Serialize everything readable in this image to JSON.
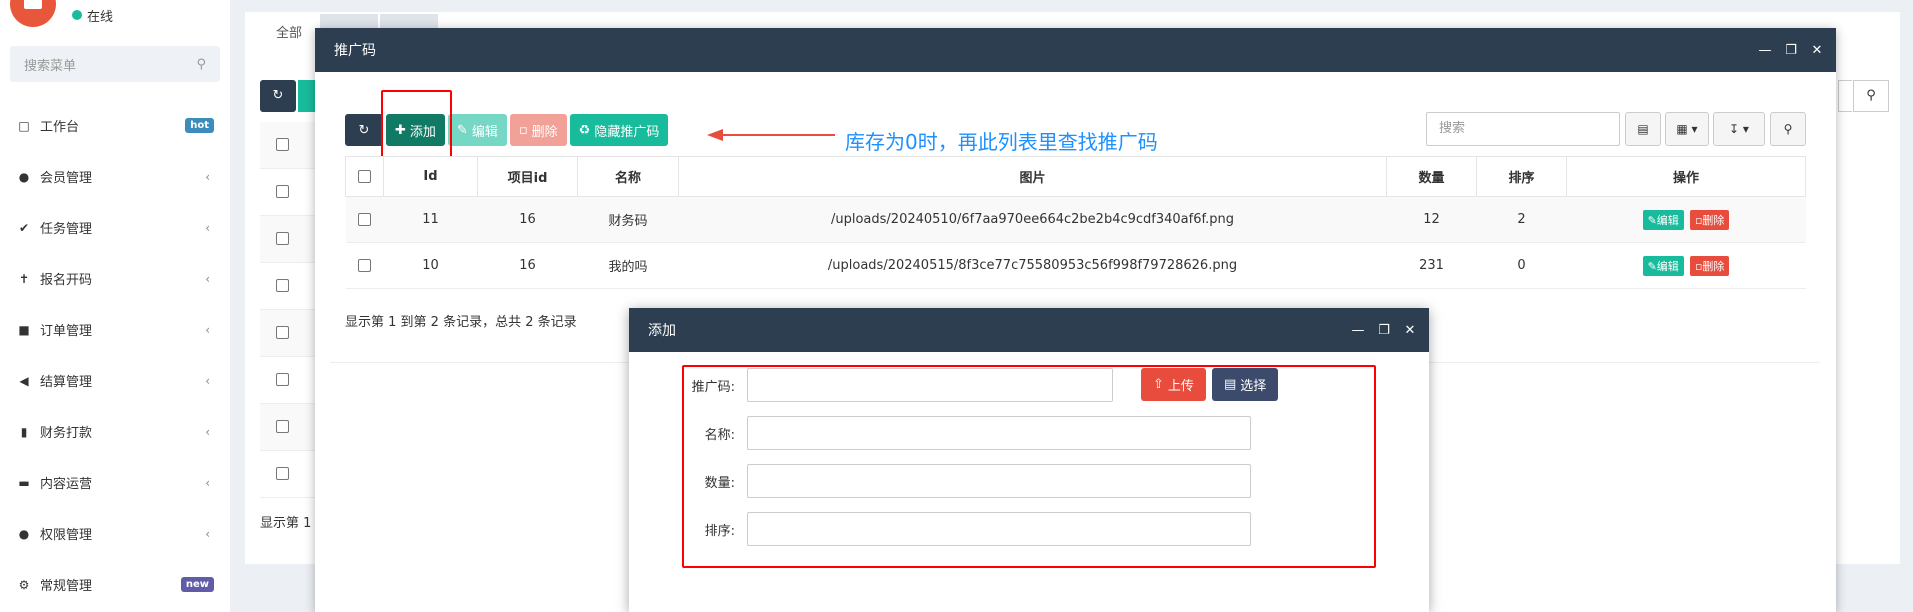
{
  "sidebar": {
    "status": "在线",
    "search_placeholder": "搜索菜单",
    "items": [
      {
        "label": "工作台",
        "icon": "monitor-icon",
        "badge": "hot"
      },
      {
        "label": "会员管理",
        "icon": "user-icon"
      },
      {
        "label": "任务管理",
        "icon": "check-icon"
      },
      {
        "label": "报名开码",
        "icon": "person-icon"
      },
      {
        "label": "订单管理",
        "icon": "folder-icon"
      },
      {
        "label": "结算管理",
        "icon": "backward-icon"
      },
      {
        "label": "财务打款",
        "icon": "signal-icon"
      },
      {
        "label": "内容运营",
        "icon": "keyboard-icon"
      },
      {
        "label": "权限管理",
        "icon": "users-icon"
      },
      {
        "label": "常规管理",
        "icon": "cogs-icon",
        "badge": "new"
      }
    ]
  },
  "background": {
    "tab_all": "全部",
    "footer": "显示第 1"
  },
  "window1": {
    "title": "推广码",
    "toolbar": {
      "add": "添加",
      "edit": "编辑",
      "delete": "删除",
      "hide": "隐藏推广码"
    },
    "annotation": "库存为0时，再此列表里查找推广码",
    "search_placeholder": "搜索",
    "columns": [
      "Id",
      "项目id",
      "名称",
      "图片",
      "数量",
      "排序",
      "操作"
    ],
    "rows": [
      {
        "id": "11",
        "project_id": "16",
        "name": "财务码",
        "image": "/uploads/20240510/6f7aa970ee664c2be2b4c9cdf340af6f.png",
        "qty": "12",
        "sort": "2"
      },
      {
        "id": "10",
        "project_id": "16",
        "name": "我的吗",
        "image": "/uploads/20240515/8f3ce77c75580953c56f998f79728626.png",
        "qty": "231",
        "sort": "0"
      }
    ],
    "row_edit": "编辑",
    "row_delete": "删除",
    "footer": "显示第 1 到第 2 条记录，总共 2 条记录"
  },
  "window2": {
    "title": "添加",
    "fields": {
      "code": "推广码:",
      "name": "名称:",
      "qty": "数量:",
      "sort": "排序:"
    },
    "upload": "上传",
    "choose": "选择"
  },
  "colors": {
    "header": "#2c3e50",
    "success": "#18bc9c",
    "danger": "#e74c3c",
    "annotation": "#ff0000",
    "annotation_text": "#1e90ff"
  }
}
